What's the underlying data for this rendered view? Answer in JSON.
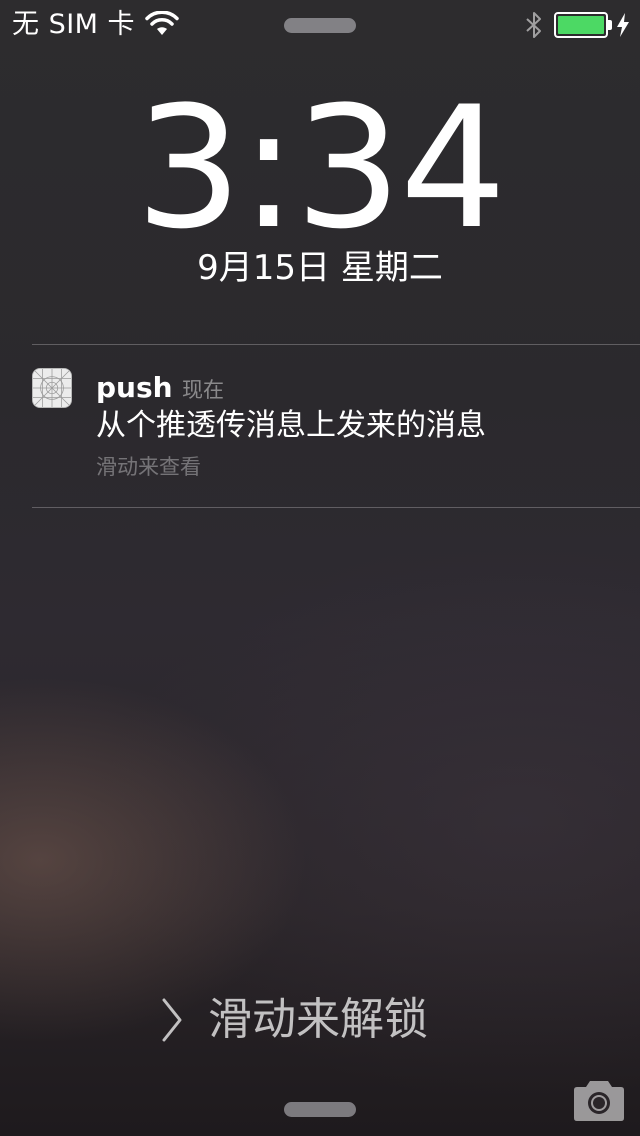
{
  "status_bar": {
    "carrier": "无 SIM 卡",
    "wifi_icon": "wifi-icon",
    "bluetooth_icon": "bluetooth-icon",
    "battery_level": 1.0,
    "battery_color": "#4cd964",
    "charging_icon": "charging-bolt-icon"
  },
  "lock_screen": {
    "time": "3:34",
    "date": "9月15日  星期二"
  },
  "notification": {
    "app_icon": "app-placeholder-icon",
    "app_name": "push",
    "time_label": "现在",
    "message": "从个推透传消息上发来的消息",
    "action_hint": "滑动来查看"
  },
  "bottom": {
    "chevron_icon": "chevron-right-icon",
    "unlock_label": "滑动来解锁",
    "camera_icon": "camera-icon"
  }
}
